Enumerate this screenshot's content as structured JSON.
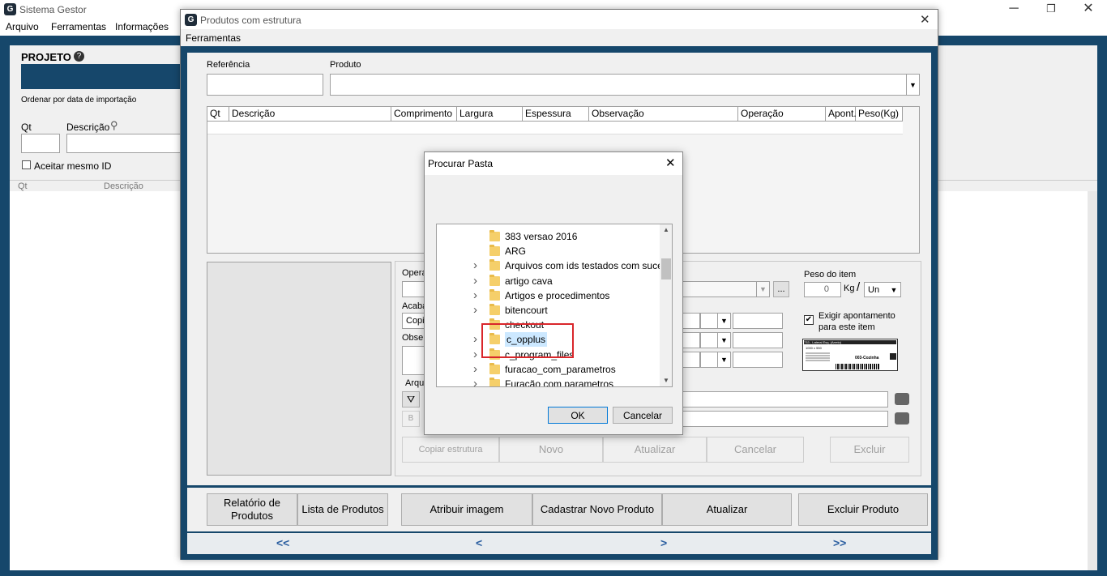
{
  "main_window": {
    "title": "Sistema Gestor",
    "menu": [
      "Arquivo",
      "Ferramentas",
      "Informações"
    ],
    "controls": {
      "minimize": "─",
      "restore": "❐",
      "close": "✕"
    }
  },
  "left_panel": {
    "projeto_label": "PROJETO",
    "sort_label": "Ordenar por data de importação",
    "qt_label": "Qt",
    "descricao_label": "Descrição",
    "aceitar_label": "Aceitar mesmo ID",
    "columns": [
      "Qt",
      "Descrição"
    ]
  },
  "dialog": {
    "title": "Produtos com estrutura",
    "menu": "Ferramentas",
    "referencia_label": "Referência",
    "produto_label": "Produto",
    "columns": [
      "Qt",
      "Descrição",
      "Comprimento",
      "Largura",
      "Espessura",
      "Observação",
      "Operação",
      "Apont.",
      "Peso(Kg)"
    ],
    "operacao_label": "Opera",
    "acabamento_label": "Acaba",
    "acabamento_value": "Copia",
    "observacao_label": "Obser",
    "arquivo_label": "Arqui",
    "peso_label": "Peso do item",
    "peso_value": "0",
    "peso_unit": "Kg",
    "peso_sep": "/",
    "unit_select": "Un",
    "exigir_label_1": "Exigir apontamento",
    "exigir_label_2": "para este item",
    "ellipsis": "...",
    "buttons": {
      "copiar": "Copiar estrutura",
      "novo": "Novo",
      "atualizar": "Atualizar",
      "cancelar": "Cancelar",
      "excluir": "Excluir"
    },
    "bottom_buttons": {
      "relatorio": "Relatório de Produtos",
      "lista": "Lista de Produtos",
      "atribuir": "Atribuir imagem",
      "cadastrar": "Cadastrar Novo Produto",
      "atualizar": "Atualizar",
      "excluir": "Excluir Produto"
    },
    "nav": {
      "first": "<<",
      "prev": "<",
      "next": ">",
      "last": ">>"
    }
  },
  "folder_dialog": {
    "title": "Procurar Pasta",
    "items": [
      {
        "label": "383 versao 2016",
        "expandable": false
      },
      {
        "label": "ARG",
        "expandable": false
      },
      {
        "label": "Arquivos com ids testados com sucesso",
        "expandable": true
      },
      {
        "label": "artigo cava",
        "expandable": true
      },
      {
        "label": "Artigos e procedimentos",
        "expandable": true
      },
      {
        "label": "bitencourt",
        "expandable": true
      },
      {
        "label": "checkout",
        "expandable": false
      },
      {
        "label": "c_opplus",
        "expandable": true,
        "selected": true
      },
      {
        "label": "c_program_files",
        "expandable": true
      },
      {
        "label": "furacao_com_parametros",
        "expandable": true
      },
      {
        "label": "Furação com parametros",
        "expandable": true
      }
    ],
    "ok": "OK",
    "cancel": "Cancelar"
  },
  "label_preview": {
    "line1": "733 - Lateral Esq. (Arreio)",
    "line2": "1000 x 550",
    "footer": "003-Cozinha"
  },
  "colors": {
    "frame": "#16476b",
    "highlight_box": "#d9262b",
    "selection": "#cce8ff"
  }
}
